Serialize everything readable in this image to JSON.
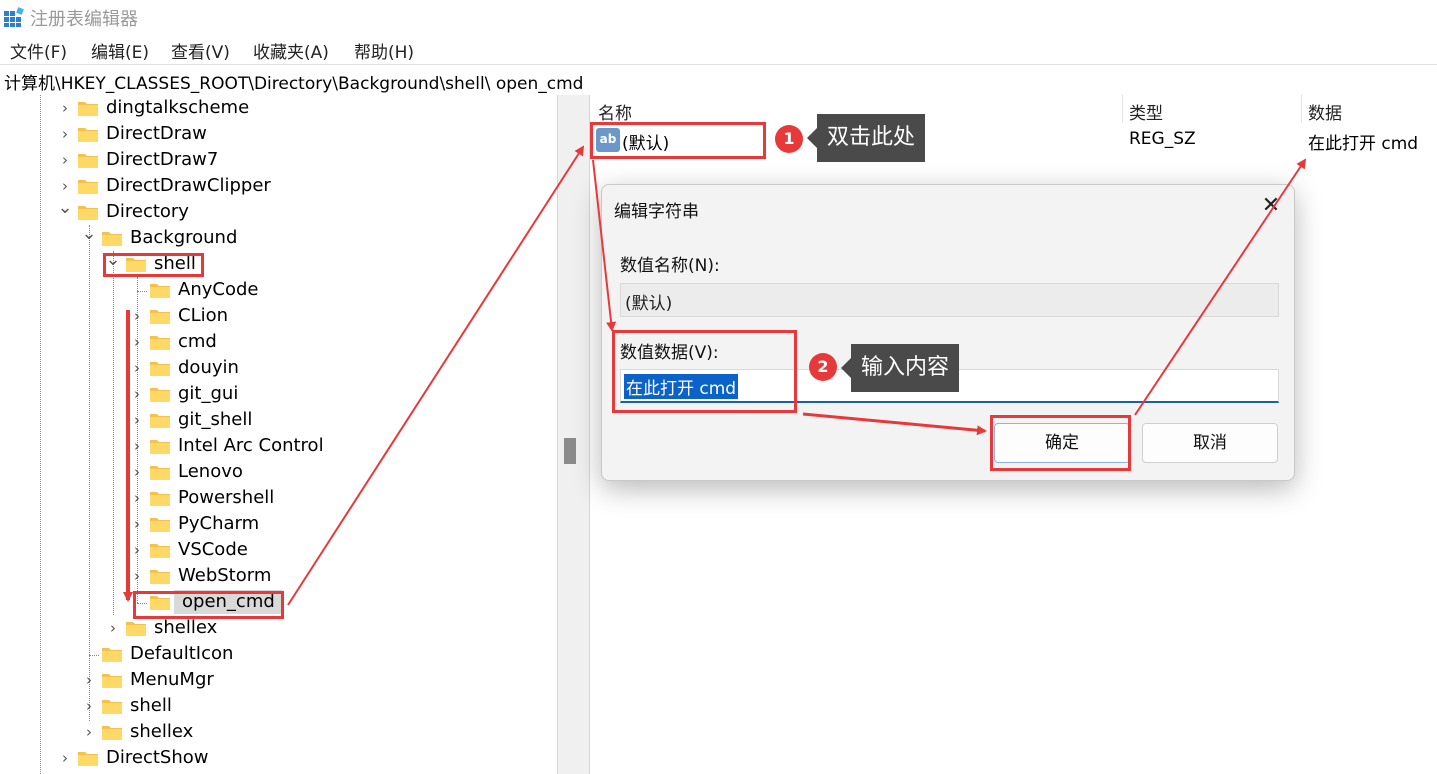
{
  "window": {
    "title": "注册表编辑器"
  },
  "menu": [
    "文件(F)",
    "编辑(E)",
    "查看(V)",
    "收藏夹(A)",
    "帮助(H)"
  ],
  "address": "计算机\\HKEY_CLASSES_ROOT\\Directory\\Background\\shell\\ open_cmd",
  "tree": [
    {
      "label": "dingtalkscheme",
      "expand": "closed"
    },
    {
      "label": "DirectDraw",
      "expand": "closed"
    },
    {
      "label": "DirectDraw7",
      "expand": "closed"
    },
    {
      "label": "DirectDrawClipper",
      "expand": "closed"
    },
    {
      "label": "Directory",
      "expand": "open"
    },
    {
      "label": "Background",
      "expand": "open"
    },
    {
      "label": "shell",
      "expand": "open"
    },
    {
      "label": "AnyCode",
      "expand": "none"
    },
    {
      "label": "CLion",
      "expand": "closed"
    },
    {
      "label": "cmd",
      "expand": "closed"
    },
    {
      "label": "douyin",
      "expand": "closed"
    },
    {
      "label": "git_gui",
      "expand": "closed"
    },
    {
      "label": "git_shell",
      "expand": "closed"
    },
    {
      "label": "Intel Arc Control",
      "expand": "closed"
    },
    {
      "label": "Lenovo",
      "expand": "closed"
    },
    {
      "label": "Powershell",
      "expand": "closed"
    },
    {
      "label": "PyCharm",
      "expand": "closed"
    },
    {
      "label": "VSCode",
      "expand": "closed"
    },
    {
      "label": "WebStorm",
      "expand": "closed"
    },
    {
      "label": "open_cmd",
      "expand": "none",
      "selected": true
    },
    {
      "label": "shellex",
      "expand": "closed"
    },
    {
      "label": "DefaultIcon",
      "expand": "none"
    },
    {
      "label": "MenuMgr",
      "expand": "closed"
    },
    {
      "label": "shell",
      "expand": "closed"
    },
    {
      "label": "shellex",
      "expand": "closed"
    },
    {
      "label": "DirectShow",
      "expand": "closed"
    }
  ],
  "list": {
    "headers": {
      "name": "名称",
      "type": "类型",
      "data": "数据"
    },
    "rows": [
      {
        "icon": "ab",
        "name": "(默认)",
        "type": "REG_SZ",
        "data": "在此打开 cmd"
      }
    ]
  },
  "dialog": {
    "title": "编辑字符串",
    "name_label": "数值名称(N):",
    "name_value": "(默认)",
    "data_label": "数值数据(V):",
    "data_value": "在此打开 cmd",
    "ok": "确定",
    "cancel": "取消"
  },
  "annotations": {
    "step1_badge": "1",
    "step1_text": "双击此处",
    "step2_badge": "2",
    "step2_text": "输入内容",
    "color": "#e8393a"
  }
}
